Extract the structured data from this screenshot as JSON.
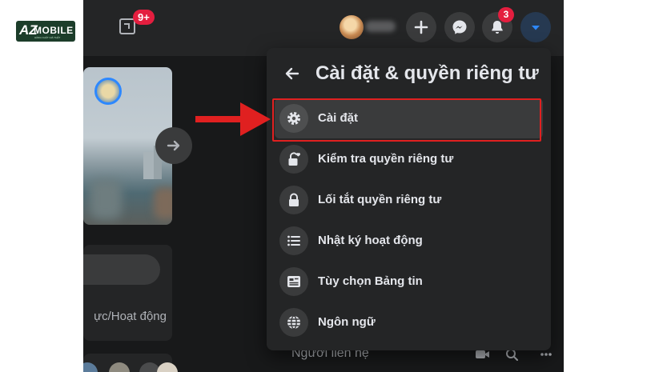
{
  "watermark": {
    "brand_az": "AZ",
    "brand_mobile": "MOBILE",
    "brand_tagline": "HÀNG CHẤT GIÁ THẬT"
  },
  "topbar": {
    "gaming_badge": "9+",
    "notification_badge": "3",
    "icons": [
      "gaming-icon",
      "plus-icon",
      "messenger-icon",
      "bell-icon",
      "caret-down-icon"
    ]
  },
  "dropdown": {
    "title": "Cài đặt & quyền riêng tư",
    "items": [
      {
        "label": "Cài đặt",
        "icon": "gear-icon",
        "selected": true
      },
      {
        "label": "Kiểm tra quyền riêng tư",
        "icon": "lock-heart-icon"
      },
      {
        "label": "Lối tắt quyền riêng tư",
        "icon": "lock-icon"
      },
      {
        "label": "Nhật ký hoạt động",
        "icon": "list-icon"
      },
      {
        "label": "Tùy chọn Bảng tin",
        "icon": "feed-icon"
      },
      {
        "label": "Ngôn ngữ",
        "icon": "globe-icon"
      }
    ]
  },
  "left_panel": {
    "activity_text": "ực/Hoạt động"
  },
  "contacts": {
    "title": "Người liên hệ"
  },
  "colors": {
    "highlight": "#e02020",
    "arrow": "#e02020",
    "badge": "#e41e3f"
  }
}
